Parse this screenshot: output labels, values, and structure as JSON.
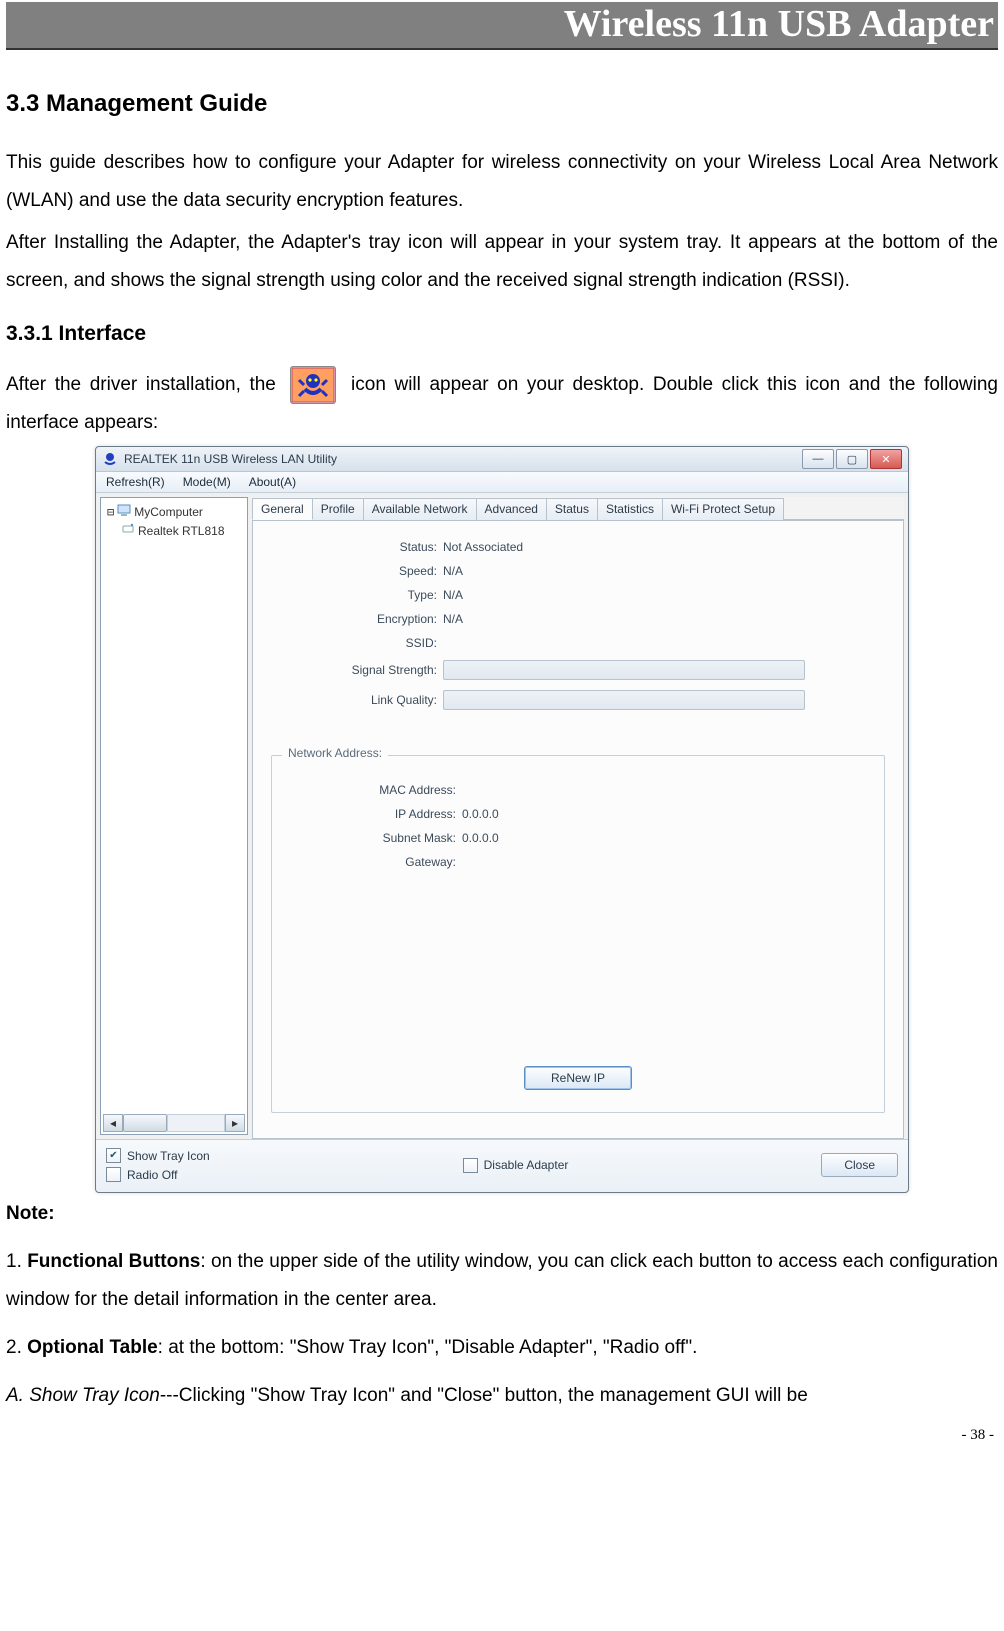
{
  "banner": "Wireless 11n USB Adapter",
  "section_heading": "3.3    Management Guide",
  "intro_para1": "This guide describes how to configure your Adapter for wireless connectivity on your Wireless Local Area Network (WLAN) and use the data security encryption features.",
  "intro_para2": "After Installing the Adapter, the Adapter's tray icon will appear in your system tray. It appears at the bottom of the screen, and shows the signal strength using color and the received signal strength indication (RSSI).",
  "subsection_heading": "3.3.1    Interface",
  "after_install_pre": "After the driver installation, the ",
  "after_install_post": " icon will appear on your desktop. Double click this icon and the following interface appears:",
  "note_label": "Note:",
  "bullet1_num": "1. ",
  "bullet1_bold": "Functional Buttons",
  "bullet1_rest": ": on the upper side of the utility window, you can click each button to access each configuration window for the detail information in the center area.",
  "bullet2_num": "2. ",
  "bullet2_bold": "Optional Table",
  "bullet2_rest": ": at the bottom: \"Show Tray Icon\", \"Disable Adapter\", \"Radio off\".",
  "bullet3_it": "A. Show Tray Icon",
  "bullet3_rest": "---Clicking \"Show Tray Icon\" and \"Close\" button, the management GUI will be",
  "page_number": "- 38 -",
  "win": {
    "title": "REALTEK 11n USB Wireless LAN Utility",
    "menus": {
      "refresh": "Refresh(R)",
      "mode": "Mode(M)",
      "about": "About(A)"
    },
    "tree": {
      "root": "MyComputer",
      "child": "Realtek RTL818"
    },
    "tabs": {
      "general": "General",
      "profile": "Profile",
      "available": "Available Network",
      "advanced": "Advanced",
      "status": "Status",
      "statistics": "Statistics",
      "wps": "Wi-Fi Protect Setup"
    },
    "fields": {
      "status_label": "Status:",
      "status_value": "Not Associated",
      "speed_label": "Speed:",
      "speed_value": "N/A",
      "type_label": "Type:",
      "type_value": "N/A",
      "encryption_label": "Encryption:",
      "encryption_value": "N/A",
      "ssid_label": "SSID:",
      "ssid_value": "",
      "sigstr_label": "Signal Strength:",
      "linkq_label": "Link Quality:"
    },
    "group": {
      "title": "Network Address:",
      "mac_label": "MAC Address:",
      "mac_value": "",
      "ip_label": "IP Address:",
      "ip_value": "0.0.0.0",
      "mask_label": "Subnet Mask:",
      "mask_value": "0.0.0.0",
      "gw_label": "Gateway:",
      "gw_value": "",
      "renew_btn": "ReNew IP"
    },
    "footer": {
      "show_tray": "Show Tray Icon",
      "radio_off": "Radio Off",
      "disable_adapter": "Disable Adapter",
      "close_btn": "Close"
    }
  }
}
